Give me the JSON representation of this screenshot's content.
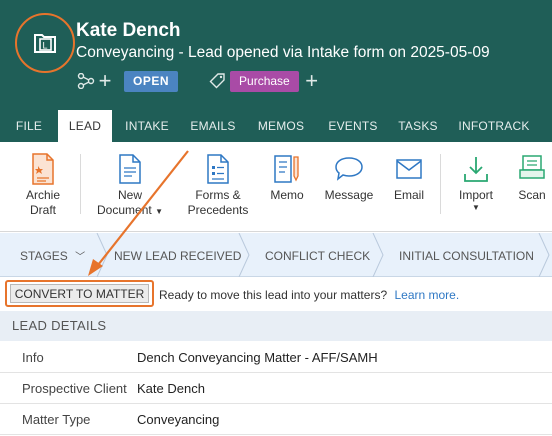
{
  "header": {
    "title": "Kate Dench",
    "subtitle": "Conveyancing - Lead opened via Intake form on 2025-05-09",
    "status_badge": "OPEN",
    "tag_badge": "Purchase",
    "colors": {
      "header_bg": "#1f5e57",
      "accent": "#e7742c",
      "open_badge": "#4b84c1",
      "purchase_badge": "#a94ba6"
    }
  },
  "tabs": [
    {
      "label": "FILE",
      "active": false
    },
    {
      "label": "LEAD",
      "active": true
    },
    {
      "label": "INTAKE",
      "active": false
    },
    {
      "label": "EMAILS",
      "active": false
    },
    {
      "label": "MEMOS",
      "active": false
    },
    {
      "label": "EVENTS",
      "active": false
    },
    {
      "label": "TASKS",
      "active": false
    },
    {
      "label": "INFOTRACK",
      "active": false
    }
  ],
  "ribbon": {
    "archie": {
      "line1": "Archie",
      "line2": "Draft",
      "icon": "archie-draft-icon"
    },
    "new_document": {
      "line1": "New",
      "line2": "Document",
      "icon": "document-icon"
    },
    "forms": {
      "line1": "Forms &",
      "line2": "Precedents",
      "icon": "forms-icon"
    },
    "memo": {
      "label": "Memo",
      "icon": "memo-icon"
    },
    "message": {
      "label": "Message",
      "icon": "message-icon"
    },
    "email": {
      "label": "Email",
      "icon": "email-icon"
    },
    "import": {
      "label": "Import",
      "icon": "import-icon"
    },
    "scan": {
      "label": "Scan",
      "icon": "scan-icon"
    }
  },
  "stages": {
    "label": "STAGES",
    "items": [
      "NEW LEAD RECEIVED",
      "CONFLICT CHECK",
      "INITIAL CONSULTATION"
    ]
  },
  "notice": {
    "button": "CONVERT TO MATTER",
    "text": "Ready to move this lead into your matters?",
    "link": "Learn more."
  },
  "details": {
    "heading": "LEAD DETAILS",
    "rows": [
      {
        "label": "Info",
        "value": "Dench Conveyancing Matter - AFF/SAMH"
      },
      {
        "label": "Prospective Client",
        "value": "Kate Dench"
      },
      {
        "label": "Matter Type",
        "value": "Conveyancing"
      }
    ]
  }
}
